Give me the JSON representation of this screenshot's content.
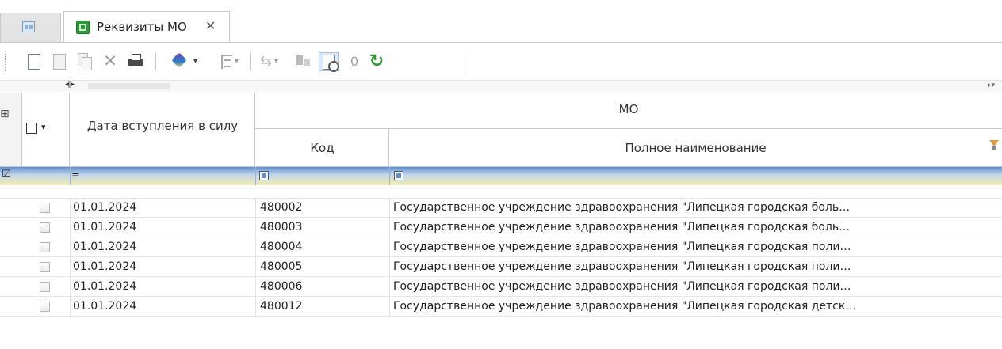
{
  "tabs": {
    "home_icon": "grid-icon",
    "active": {
      "title": "Реквизиты МО",
      "close_label": "✕"
    }
  },
  "toolbar": {
    "icons": [
      "new-doc-icon",
      "edit-doc-icon",
      "copy-doc-icon",
      "delete-icon",
      "print-icon",
      "brush-icon",
      "dropdown-icon",
      "tree-icon",
      "link-icon",
      "hierarchy-icon",
      "history-icon",
      "paperclip-icon",
      "refresh-icon"
    ],
    "delete_glyph": "✕",
    "clip_glyph": "0",
    "refresh_glyph": "↻",
    "dropdown_glyph": "▾"
  },
  "grid": {
    "scroll_arrows": "◂||▸",
    "scroll_right": "▸▾",
    "columns": {
      "check_dropdown": "▾",
      "date_header": "Дата вступления в силу",
      "mo_group": "МО",
      "kod_header": "Код",
      "kod_sort": "⁄",
      "name_header": "Полное наименование"
    },
    "filter": {
      "row_icon": "☑",
      "date_op": "="
    },
    "rows": [
      {
        "date": "01.01.2024",
        "kod": "480002",
        "name": "Государственное учреждение здравоохранения \"Липецкая городская боль…"
      },
      {
        "date": "01.01.2024",
        "kod": "480003",
        "name": "Государственное учреждение здравоохранения \"Липецкая городская боль…"
      },
      {
        "date": "01.01.2024",
        "kod": "480004",
        "name": "Государственное учреждение здравоохранения \"Липецкая городская поли…"
      },
      {
        "date": "01.01.2024",
        "kod": "480005",
        "name": "Государственное учреждение здравоохранения \"Липецкая городская поли…"
      },
      {
        "date": "01.01.2024",
        "kod": "480006",
        "name": "Государственное учреждение здравоохранения \"Липецкая городская поли…"
      },
      {
        "date": "01.01.2024",
        "kod": "480012",
        "name": "Государственное учреждение здравоохранения \"Липецкая городская детск…"
      }
    ]
  },
  "colors": {
    "filter_top": "#5f8fd0",
    "filter_bottom": "#f3eeb0",
    "refresh": "#2f9a36",
    "tab_icon": "#2e9a3a"
  }
}
